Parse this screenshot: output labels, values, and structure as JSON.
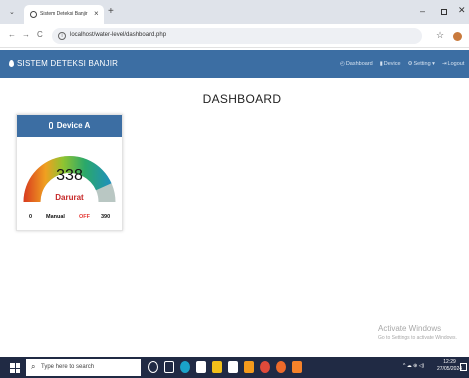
{
  "browser": {
    "tab_title": "Sistem Deteksi Banjir",
    "tab_close": "×",
    "new_tab": "+",
    "url": "localhost/water-level/dashboard.php",
    "back": "←",
    "forward": "→",
    "reload": "C",
    "info": "i",
    "star": "☆",
    "minimize": "–",
    "close": "✕"
  },
  "navbar": {
    "brand": "SISTEM DETEKSI BANJIR",
    "items": [
      {
        "icon": "gauge-icon",
        "label": "Dashboard"
      },
      {
        "icon": "device-icon",
        "label": "Device"
      },
      {
        "icon": "gears-icon",
        "label": "Setting"
      },
      {
        "icon": "logout-icon",
        "label": "Logout"
      }
    ]
  },
  "page": {
    "title": "DASHBOARD"
  },
  "device_card": {
    "title": "Device A",
    "value": "338",
    "value_num": 338,
    "min": "0",
    "min_num": 0,
    "max": "390",
    "max_num": 390,
    "status": "Darurat",
    "mode": "Manual",
    "state": "OFF"
  },
  "watermark": {
    "title": "Activate Windows",
    "subtitle": "Go to Settings to activate Windows."
  },
  "taskbar": {
    "search_placeholder": "Type here to search",
    "tray": "^ ☁ ⊕ ◁)",
    "time": "12:29",
    "date": "27/05/2024"
  }
}
